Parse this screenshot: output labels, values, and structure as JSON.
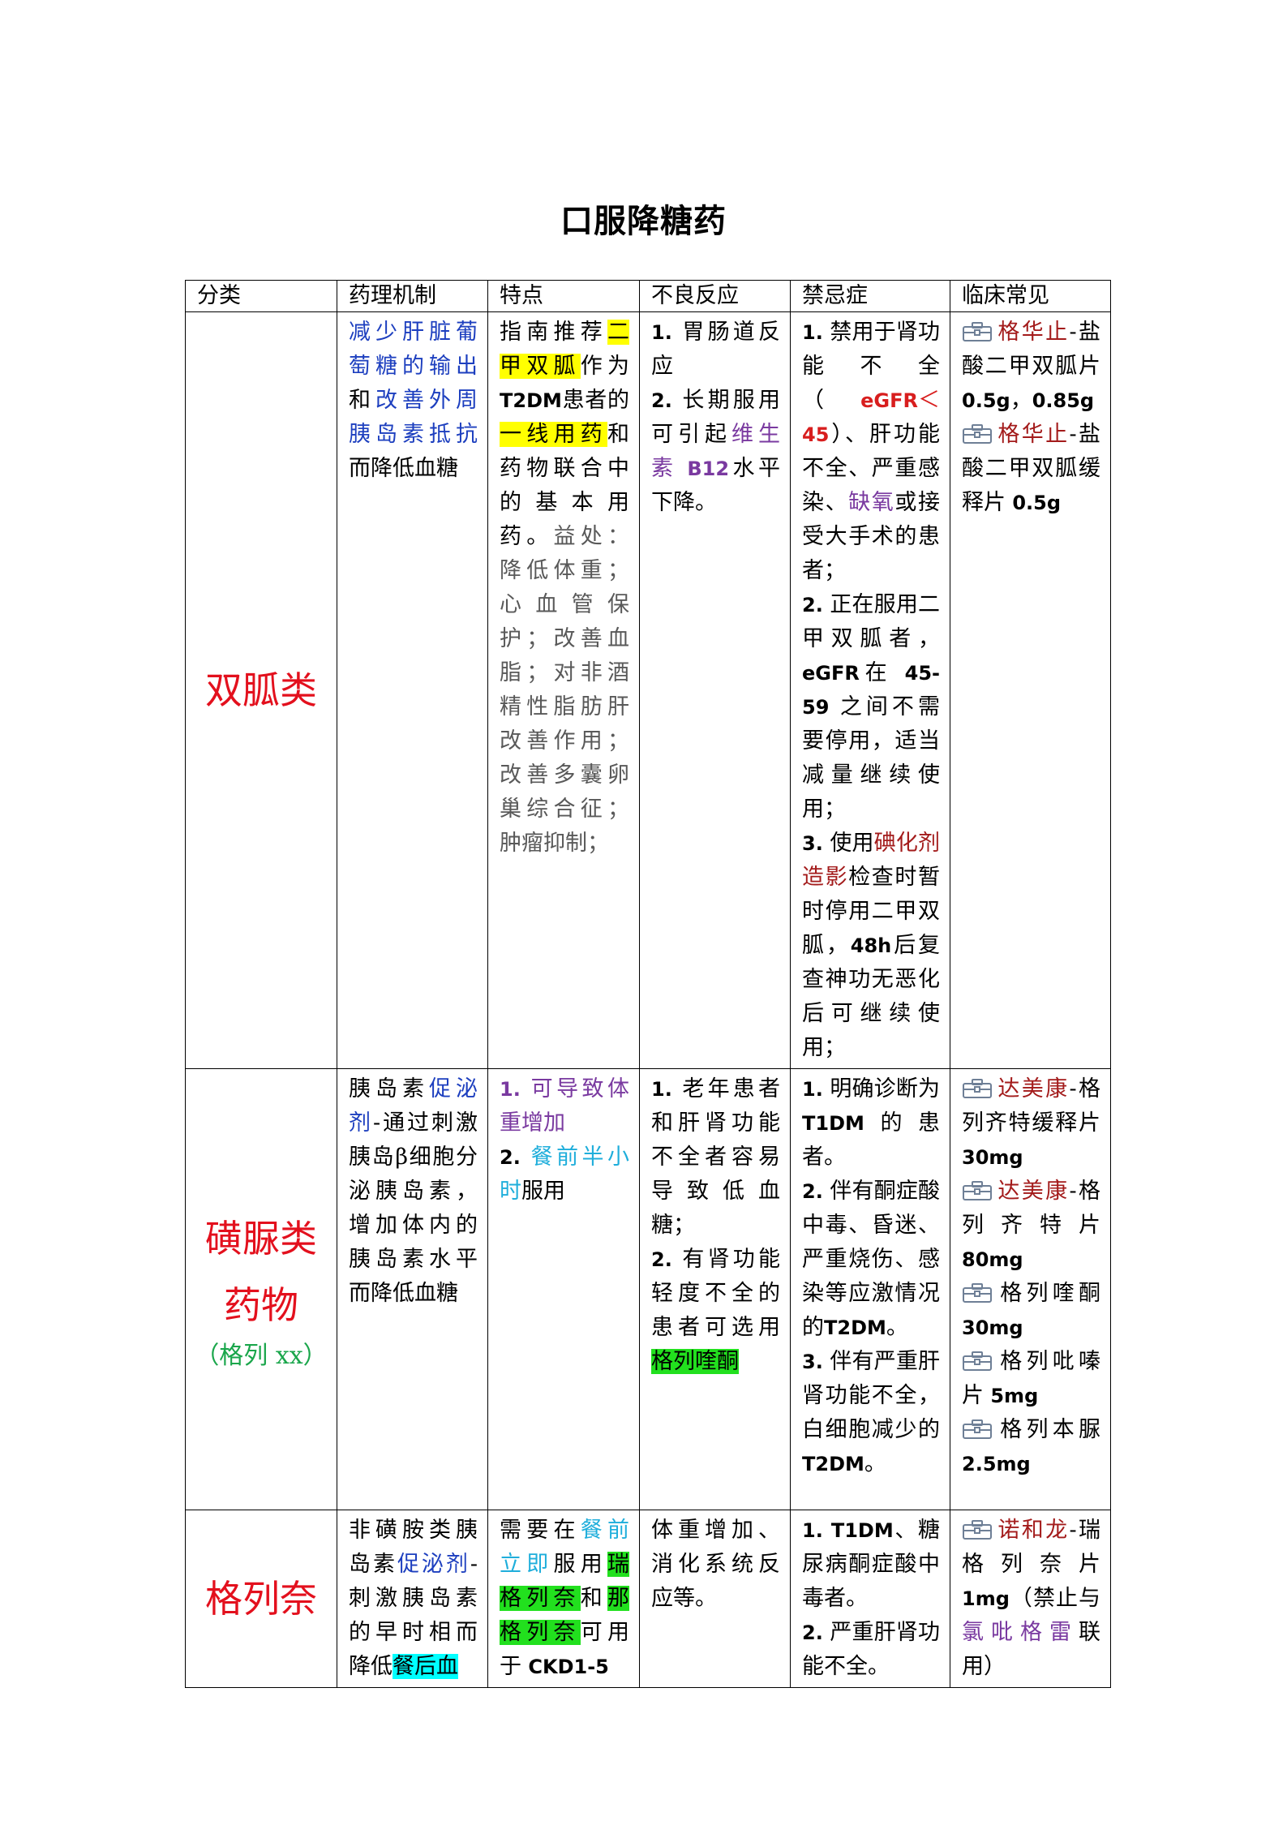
{
  "title": "口服降糖药",
  "headers": [
    "分类",
    "药理机制",
    "特点",
    "不良反应",
    "禁忌症",
    "临床常见"
  ],
  "rows": [
    {
      "category": "双胍类",
      "mechanism": [
        {
          "t": "减少肝脏葡萄糖的输出",
          "c": "blue"
        },
        {
          "t": "和"
        },
        {
          "t": "改善外周胰岛素抵抗",
          "c": "blue"
        },
        {
          "t": "而降低血糖"
        }
      ],
      "features": [
        {
          "t": "指南推荐"
        },
        {
          "t": "二甲双胍",
          "h": "hl-y"
        },
        {
          "t": "作为"
        },
        {
          "t": "T2DM",
          "b": true
        },
        {
          "t": "患者的"
        },
        {
          "t": "一线用药",
          "h": "hl-y"
        },
        {
          "t": "和药物联合中的基本用药。"
        },
        {
          "t": "益处：降低体重；心血管保护；改善血脂；对非酒精性脂肪肝改善作用；改善多囊卵巢综合征；肿瘤抑制；",
          "c": "gray"
        }
      ],
      "adverse": [
        [
          {
            "t": "1. ",
            "b": true
          },
          {
            "t": "胃肠道反应"
          }
        ],
        [
          {
            "t": "2. ",
            "b": true
          },
          {
            "t": "长期服用可引起"
          },
          {
            "t": "维生素",
            "c": "purple"
          },
          {
            "t": " B12",
            "c": "purple",
            "b": true
          },
          {
            "t": "水平下降。"
          }
        ]
      ],
      "contra": [
        [
          {
            "t": "1. ",
            "b": true
          },
          {
            "t": "禁用于肾功能不全（"
          },
          {
            "t": "eGFR",
            "c": "red",
            "b": true
          },
          {
            "t": "＜",
            "c": "red"
          },
          {
            "t": "45",
            "c": "red",
            "b": true
          },
          {
            "t": "）、肝功能不全、严重感染、"
          },
          {
            "t": "缺氧",
            "c": "purple"
          },
          {
            "t": "或接受大手术的患者；"
          }
        ],
        [
          {
            "t": "2. ",
            "b": true
          },
          {
            "t": "正在服用二甲双胍者，"
          },
          {
            "t": "eGFR",
            "b": true
          },
          {
            "t": "在"
          },
          {
            "t": " 45-59 ",
            "b": true
          },
          {
            "t": "之间不需要停用，适当减量继续使用；"
          }
        ],
        [
          {
            "t": "3. ",
            "b": true
          },
          {
            "t": "使用"
          },
          {
            "t": "碘化剂造影",
            "c": "darkred"
          },
          {
            "t": "检查时暂时停用二甲双胍，"
          },
          {
            "t": "48h",
            "b": true
          },
          {
            "t": "后复查神功无恶化后可继续使用；"
          }
        ]
      ],
      "clinical": [
        [
          {
            "icon": true
          },
          {
            "t": "格华止",
            "c": "darkred"
          },
          {
            "t": "-盐酸二甲双胍片"
          },
          {
            "t": " 0.5g",
            "b": true
          },
          {
            "t": "，"
          },
          {
            "t": "0.85g",
            "b": true
          }
        ],
        [
          {
            "icon": true
          },
          {
            "t": "格华止",
            "c": "darkred"
          },
          {
            "t": "-盐酸二甲双胍缓释片"
          },
          {
            "t": " 0.5g",
            "b": true
          }
        ]
      ]
    },
    {
      "category": "磺脲类药物",
      "category_sub": "（格列 xx）",
      "mechanism": [
        {
          "t": "胰岛素"
        },
        {
          "t": "促泌剂",
          "c": "blue"
        },
        {
          "t": "-通过刺激胰岛β细胞分泌胰岛素，增加体内的胰岛素水平而降低血糖"
        }
      ],
      "features": [
        {
          "t": "1. ",
          "c": "purple",
          "b": true
        },
        {
          "t": "可导致体重增加",
          "c": "purple"
        },
        {
          "t": "BR"
        },
        {
          "t": "2. ",
          "b": true
        },
        {
          "t": "餐前半小时",
          "c": "cyan"
        },
        {
          "t": "服用"
        }
      ],
      "adverse": [
        [
          {
            "t": "1. ",
            "b": true
          },
          {
            "t": "老年患者和肝肾功能不全者容易导致低血糖；"
          }
        ],
        [
          {
            "t": "2. ",
            "b": true
          },
          {
            "t": "有肾功能轻度不全的患者可选用"
          },
          {
            "t": "格列喹酮",
            "h": "hl-g"
          }
        ]
      ],
      "contra": [
        [
          {
            "t": "1. ",
            "b": true
          },
          {
            "t": "明确诊断为"
          },
          {
            "t": "T1DM",
            "b": true
          },
          {
            "t": "的患者。"
          }
        ],
        [
          {
            "t": "2. ",
            "b": true
          },
          {
            "t": "伴有酮症酸中毒、昏迷、严重烧伤、感染等应激情况的"
          },
          {
            "t": "T2DM",
            "b": true
          },
          {
            "t": "。"
          }
        ],
        [
          {
            "t": "3. ",
            "b": true
          },
          {
            "t": "伴有严重肝肾功能不全，白细胞减少的"
          },
          {
            "t": "T2DM",
            "b": true
          },
          {
            "t": "。"
          }
        ]
      ],
      "clinical": [
        [
          {
            "icon": true
          },
          {
            "t": "达美康",
            "c": "darkred"
          },
          {
            "t": "-格列齐特缓释片"
          },
          {
            "t": " 30mg",
            "b": true
          }
        ],
        [
          {
            "icon": true
          },
          {
            "t": "达美康",
            "c": "darkred"
          },
          {
            "t": "-格列齐特片"
          },
          {
            "t": " 80mg",
            "b": true
          }
        ],
        [
          {
            "icon": true
          },
          {
            "t": "格列喹酮"
          },
          {
            "t": " 30mg",
            "b": true
          }
        ],
        [
          {
            "icon": true
          },
          {
            "t": "格列吡嗪片"
          },
          {
            "t": " 5mg",
            "b": true
          }
        ],
        [
          {
            "icon": true
          },
          {
            "t": "格列本脲"
          },
          {
            "t": " 2.5mg",
            "b": true
          }
        ]
      ]
    },
    {
      "category": "格列奈",
      "mechanism": [
        {
          "t": "非磺胺类胰岛素"
        },
        {
          "t": "促泌剂",
          "c": "blue"
        },
        {
          "t": "-刺激胰岛素的早时相而降低"
        },
        {
          "t": "餐后血",
          "h": "hl-c"
        }
      ],
      "features": [
        {
          "t": "需要在"
        },
        {
          "t": "餐前立即",
          "c": "cyan"
        },
        {
          "t": "服用"
        },
        {
          "t": "瑞格列奈",
          "h": "hl-g"
        },
        {
          "t": "和"
        },
        {
          "t": "那格列奈",
          "h": "hl-g"
        },
        {
          "t": "可用于"
        },
        {
          "t": " CKD1-5",
          "b": true
        }
      ],
      "adverse": [
        [
          {
            "t": "体重增加、消化系统反应等。"
          }
        ]
      ],
      "contra": [
        [
          {
            "t": "1. ",
            "b": true
          },
          {
            "t": "T1DM",
            "b": true
          },
          {
            "t": "、糖尿病酮症酸中毒者。"
          }
        ],
        [
          {
            "t": "2. ",
            "b": true
          },
          {
            "t": "严重肝肾功能不全。"
          }
        ]
      ],
      "clinical": [
        [
          {
            "icon": true
          },
          {
            "t": "诺和龙",
            "c": "darkred"
          },
          {
            "t": "-瑞格列奈片"
          },
          {
            "t": " 1mg",
            "b": true
          },
          {
            "t": "（禁止与"
          },
          {
            "t": "氯吡格雷",
            "c": "purple"
          },
          {
            "t": "联用）"
          }
        ]
      ]
    }
  ]
}
